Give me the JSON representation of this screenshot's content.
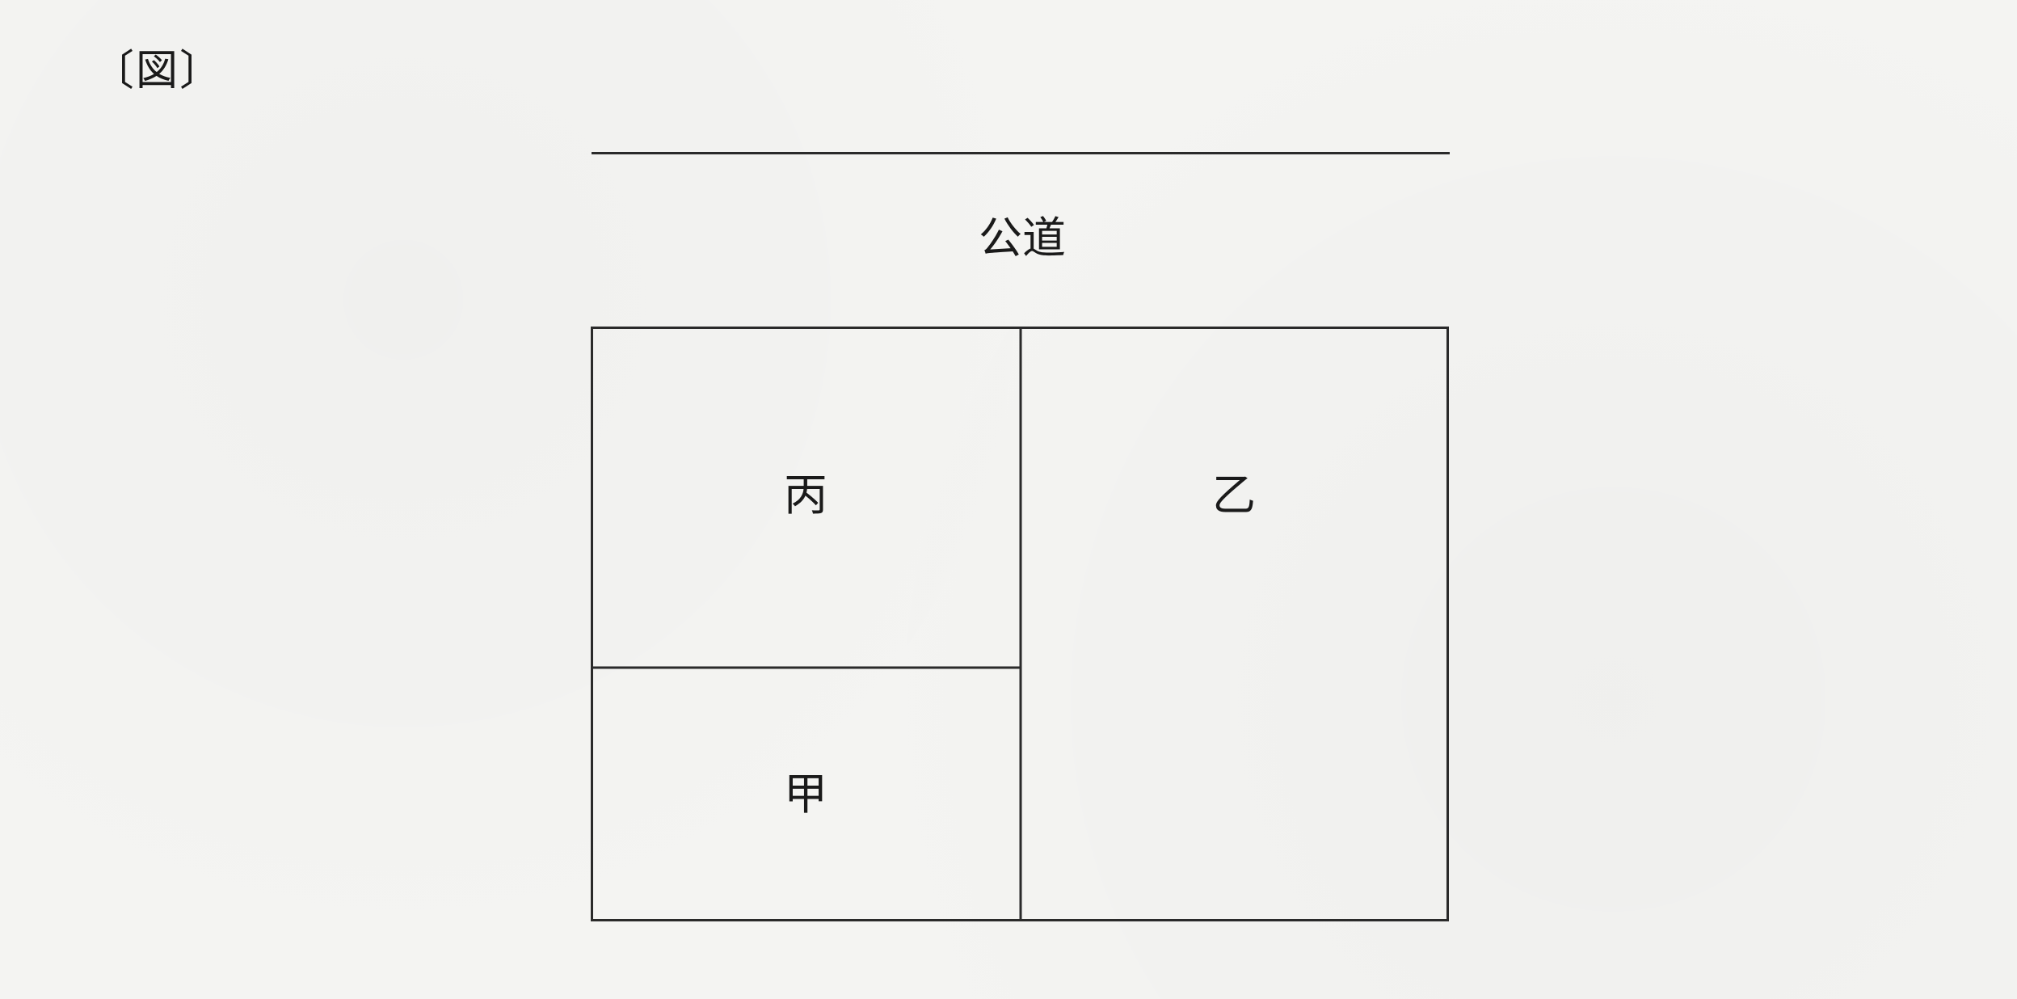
{
  "figure": {
    "label": "〔図〕"
  },
  "road": {
    "label": "公道"
  },
  "lots": {
    "hei": "丙",
    "otsu": "乙",
    "ko": "甲"
  }
}
